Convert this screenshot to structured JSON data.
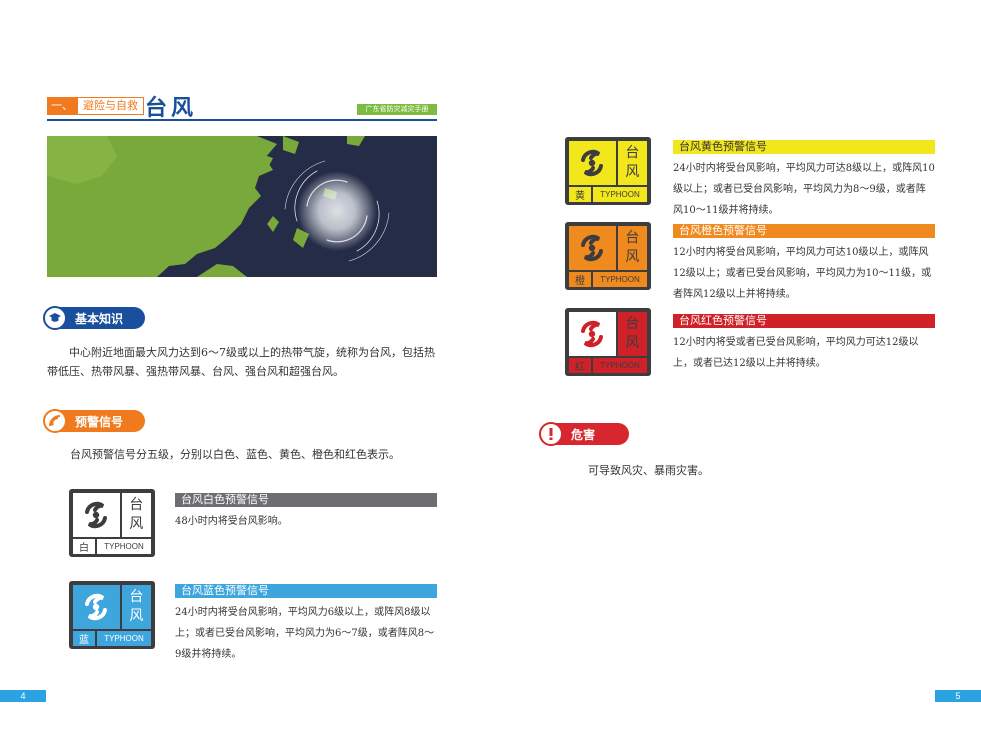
{
  "header": {
    "section_number": "一、",
    "section_name": "避险与自救",
    "title": "台风",
    "manual_badge": "广东省防灾减灾手册"
  },
  "basic": {
    "heading": "基本知识",
    "text": "中心附近地面最大风力达到6～7级或以上的热带气旋，统称为台风，包括热带低压、热带风暴、强热带风暴、台风、强台风和超强台风。"
  },
  "warning": {
    "heading": "预警信号",
    "intro": "台风预警信号分五级，分别以白色、蓝色、黄色、橙色和红色表示。"
  },
  "signals": [
    {
      "level": "白",
      "chars": [
        "台",
        "风"
      ],
      "en": "TYPHOON",
      "title": "台风白色预警信号",
      "text": "48小时内将受台风影响。",
      "color": "#6d6e71",
      "icon_bg": "#ffffff",
      "icon_fg": "#3d3d3f",
      "head_text": "#ffffff"
    },
    {
      "level": "蓝",
      "chars": [
        "台",
        "风"
      ],
      "en": "TYPHOON",
      "title": "台风蓝色预警信号",
      "text": "24小时内将受台风影响，平均风力6级以上，或阵风8级以上；或者已受台风影响，平均风力为6～7级，或者阵风8～9级并将持续。",
      "color": "#3ea5dd",
      "icon_bg": "#3ea5dd",
      "icon_fg": "#ffffff",
      "head_text": "#ffffff"
    },
    {
      "level": "黄",
      "chars": [
        "台",
        "风"
      ],
      "en": "TYPHOON",
      "title": "台风黄色预警信号",
      "text": "24小时内将受台风影响，平均风力可达8级以上，或阵风10级以上；或者已受台风影响，平均风力为8～9级，或者阵风10～11级并将持续。",
      "color": "#f2e61d",
      "icon_bg": "#f2e61d",
      "icon_fg": "#3d3d3f",
      "head_text": "#333333"
    },
    {
      "level": "橙",
      "chars": [
        "台",
        "风"
      ],
      "en": "TYPHOON",
      "title": "台风橙色预警信号",
      "text": "12小时内将受台风影响，平均风力可达10级以上，或阵风12级以上；或者已受台风影响，平均风力为10～11级，或者阵风12级以上并将持续。",
      "color": "#f08a1f",
      "icon_bg": "#f08a1f",
      "icon_fg": "#3d3d3f",
      "head_text": "#ffffff"
    },
    {
      "level": "红",
      "chars": [
        "台",
        "风"
      ],
      "en": "TYPHOON",
      "title": "台风红色预警信号",
      "text": "12小时内将受或者已受台风影响，平均风力可达12级以上，或者已达12级以上并将持续。",
      "color": "#cf2127",
      "icon_bg": "#cf2127",
      "icon_fg": "#3d3d3f",
      "head_text": "#ffffff"
    }
  ],
  "hazard": {
    "heading": "危害",
    "text": "可导致风灾、暴雨灾害。"
  },
  "pages": {
    "left": "4",
    "right": "5"
  },
  "colors": {
    "brand_blue": "#1b4f9c",
    "accent_orange": "#f07a1d",
    "hazard_red": "#d7262d",
    "page_tab": "#2ba3e3"
  }
}
